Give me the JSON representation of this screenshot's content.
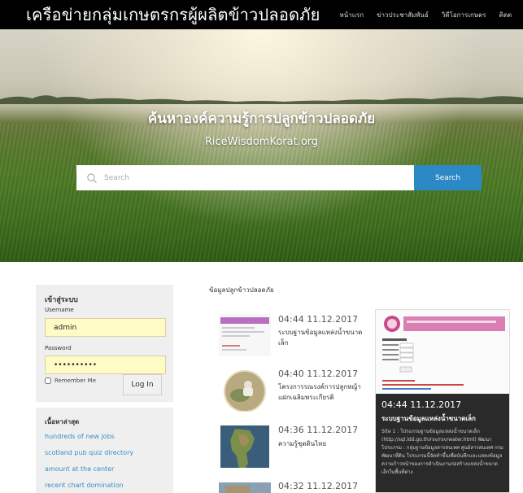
{
  "header": {
    "brand": "เครือข่ายกลุ่มเกษตรกรผู้ผลิตข้าวปลอดภัย",
    "nav": [
      "หน้าแรก",
      "ข่าวประชาสัมพันธ์",
      "วิดีโอการเกษตร",
      "ติดต"
    ]
  },
  "hero": {
    "title": "ค้นหาองค์ความรู้การปลูกข้าวปลอดภัย",
    "subtitle": "RiceWisdomKorat.org",
    "search_placeholder": "Search",
    "search_button": "Search"
  },
  "login": {
    "title": "เข้าสู่ระบบ",
    "username_label": "Username",
    "username_value": "admin",
    "password_label": "Password",
    "password_value": "••••••••••",
    "remember_label": "Remember Me",
    "login_button": "Log In"
  },
  "recent": {
    "title": "เนื้อหาล่าสุด",
    "links": [
      "hundreds of new jobs",
      "scotland pub quiz directory",
      "amount at the center",
      "recent chart domination"
    ]
  },
  "main": {
    "section_title": "ข้อมูลปลูกข้าวปลอดภัย",
    "posts": [
      {
        "time": "04:44 11.12.2017",
        "text": "ระบบฐานข้อมูลแหล่งน้ำขนาดเล็ก"
      },
      {
        "time": "04:40 11.12.2017",
        "text": "โครงการรณรงค์การปลูกหญ้าแฝกเฉลิมพระเกียรติ"
      },
      {
        "time": "04:36 11.12.2017",
        "text": "ความรู้ชุดดินไทย"
      },
      {
        "time": "04:32 11.12.2017",
        "text": ""
      }
    ],
    "featured": {
      "time": "04:44 11.12.2017",
      "title": "ระบบฐานข้อมูลแหล่งน้ำขนาดเล็ก",
      "body": "Site 1 : โปรแกรมฐานข้อมูลแหล่งน้ำขนาดเล็ก (http://sql.ldd.go.th/rsv/rsv/water.html) พัฒนาโปรแกรม : กลุ่มฐานข้อมูลสารสนเทศ ศูนย์สารสนเทศ กรมพัฒนาที่ดิน โปรแกรมนี้จัดทำขึ้นเพื่อบันทึกและแสดงข้อมูลความก้าวหน้าของการดำเนินงานก่อสร้างแหล่งน้ำขนาดเล็กในพื้นที่ต่าง"
    }
  },
  "colors": {
    "topbar": "#000000",
    "search_button": "#2c89c5",
    "link": "#3a8ec7",
    "field_fill": "#fffbc7"
  }
}
